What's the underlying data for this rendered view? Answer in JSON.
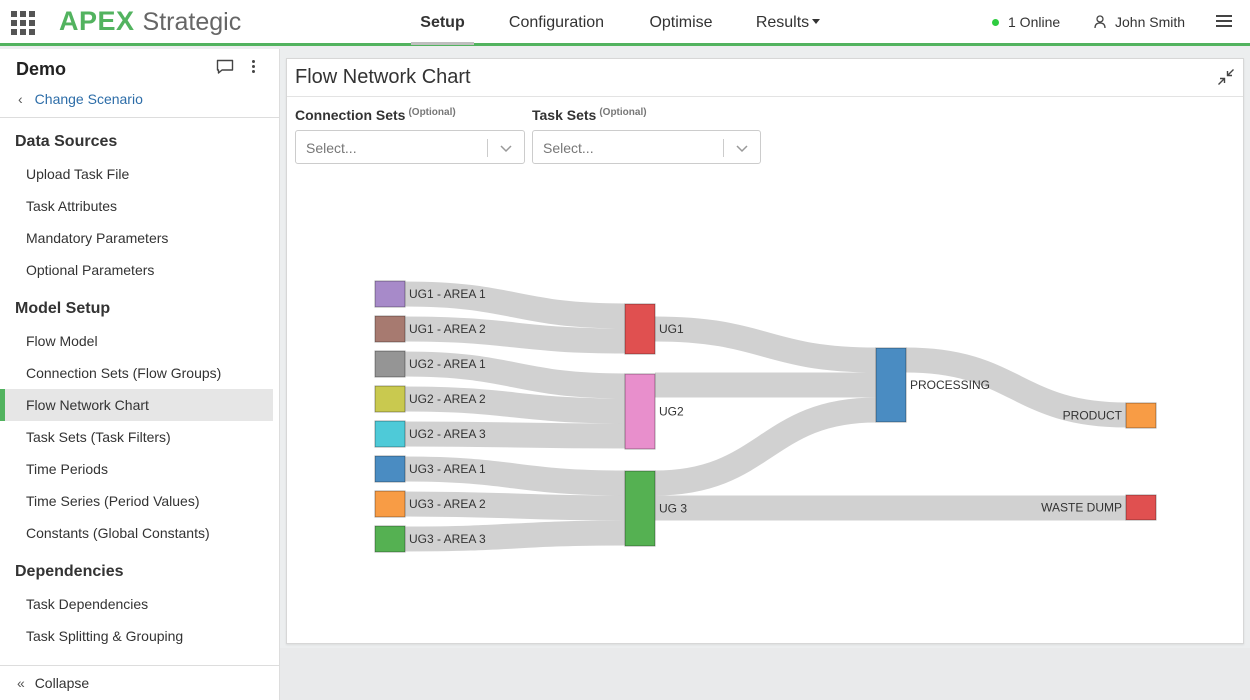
{
  "app": {
    "brand_primary": "APEX",
    "brand_secondary": "Strategic",
    "accent_color": "#52b35f"
  },
  "nav": {
    "items": [
      {
        "label": "Setup",
        "active": true
      },
      {
        "label": "Configuration",
        "active": false
      },
      {
        "label": "Optimise",
        "active": false
      },
      {
        "label": "Results",
        "active": false,
        "dropdown": true
      }
    ]
  },
  "header": {
    "online_text": "1 Online",
    "user_name": "John Smith"
  },
  "sidebar": {
    "scenario_name": "Demo",
    "change_scenario_label": "Change Scenario",
    "sections": [
      {
        "title": "Data Sources",
        "items": [
          "Upload Task File",
          "Task Attributes",
          "Mandatory Parameters",
          "Optional Parameters"
        ]
      },
      {
        "title": "Model Setup",
        "items": [
          "Flow Model",
          "Connection Sets (Flow Groups)",
          "Flow Network Chart",
          "Task Sets (Task Filters)",
          "Time Periods",
          "Time Series (Period Values)",
          "Constants (Global Constants)"
        ]
      },
      {
        "title": "Dependencies",
        "items": [
          "Task Dependencies",
          "Task Splitting & Grouping"
        ]
      }
    ],
    "active_item": "Flow Network Chart",
    "collapse_label": "Collapse"
  },
  "panel": {
    "title": "Flow Network Chart",
    "connection_sets_label": "Connection Sets",
    "connection_sets_optional": "(Optional)",
    "connection_sets_placeholder": "Select...",
    "task_sets_label": "Task Sets",
    "task_sets_optional": "(Optional)",
    "task_sets_placeholder": "Select..."
  },
  "flow_network": {
    "nodes": [
      {
        "id": "UG1 - AREA 1",
        "color": "#a78ac9"
      },
      {
        "id": "UG1 - AREA 2",
        "color": "#a77a70"
      },
      {
        "id": "UG2 - AREA 1",
        "color": "#959595"
      },
      {
        "id": "UG2 - AREA 2",
        "color": "#c9c94f"
      },
      {
        "id": "UG2 - AREA 3",
        "color": "#4ecad8"
      },
      {
        "id": "UG3 - AREA 1",
        "color": "#4a8cc2"
      },
      {
        "id": "UG3 - AREA 2",
        "color": "#f89c45"
      },
      {
        "id": "UG3 - AREA 3",
        "color": "#55b152"
      },
      {
        "id": "UG1",
        "color": "#e05050"
      },
      {
        "id": "UG2",
        "color": "#e88fcc"
      },
      {
        "id": "UG 3",
        "color": "#55b152"
      },
      {
        "id": "PROCESSING",
        "color": "#4a8cc2"
      },
      {
        "id": "PRODUCT",
        "color": "#f89c45"
      },
      {
        "id": "WASTE DUMP",
        "color": "#e05050"
      }
    ],
    "links": [
      {
        "source": "UG1 - AREA 1",
        "target": "UG1"
      },
      {
        "source": "UG1 - AREA 2",
        "target": "UG1"
      },
      {
        "source": "UG2 - AREA 1",
        "target": "UG2"
      },
      {
        "source": "UG2 - AREA 2",
        "target": "UG2"
      },
      {
        "source": "UG2 - AREA 3",
        "target": "UG2"
      },
      {
        "source": "UG3 - AREA 1",
        "target": "UG 3"
      },
      {
        "source": "UG3 - AREA 2",
        "target": "UG 3"
      },
      {
        "source": "UG3 - AREA 3",
        "target": "UG 3"
      },
      {
        "source": "UG1",
        "target": "PROCESSING"
      },
      {
        "source": "UG2",
        "target": "PROCESSING"
      },
      {
        "source": "UG 3",
        "target": "PROCESSING"
      },
      {
        "source": "UG 3",
        "target": "WASTE DUMP"
      },
      {
        "source": "PROCESSING",
        "target": "PRODUCT"
      }
    ]
  }
}
